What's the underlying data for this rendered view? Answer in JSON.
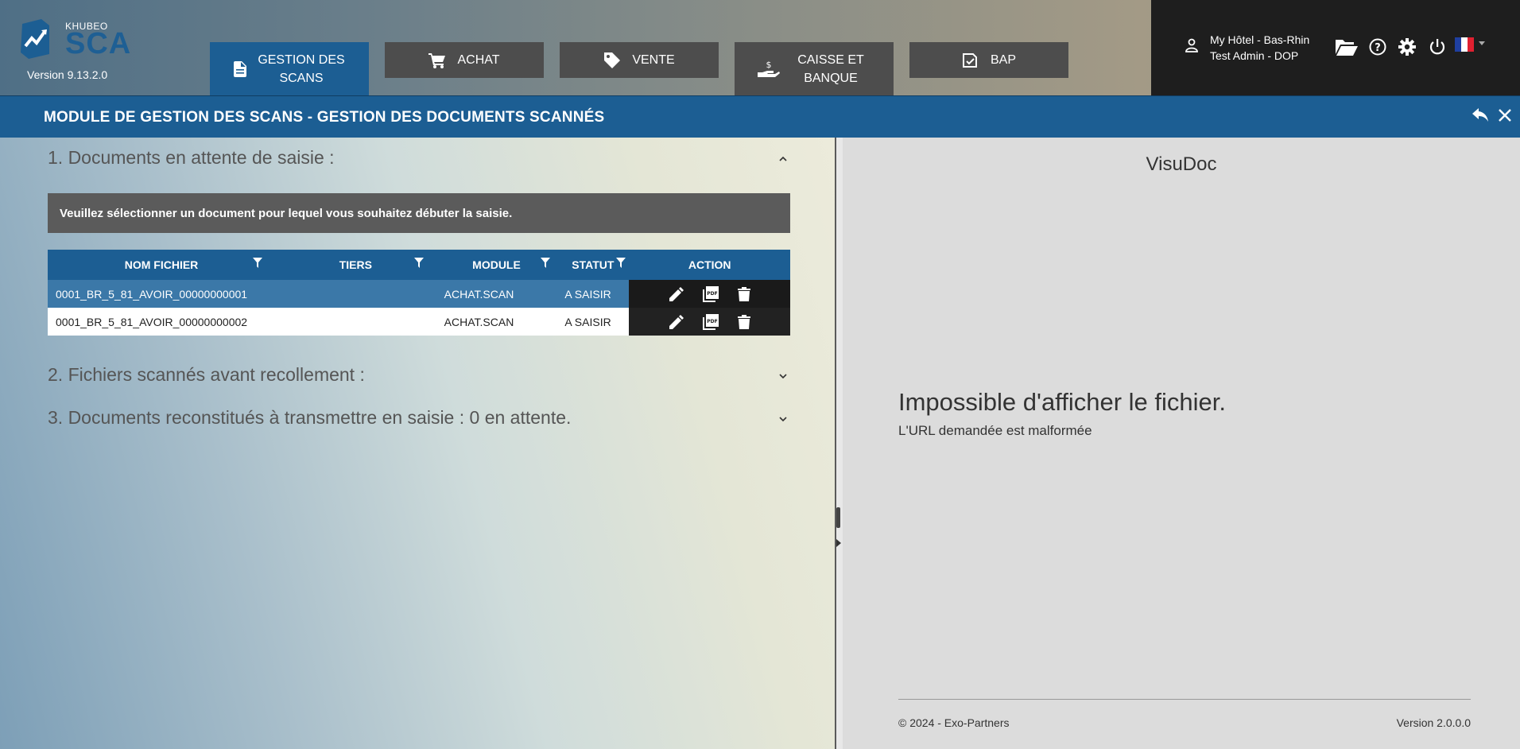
{
  "app": {
    "logo_brand": "KHUBEO",
    "logo_product": "SCA",
    "version": "Version 9.13.2.0"
  },
  "nav": {
    "items": [
      {
        "label": "GESTION DES SCANS",
        "icon": "document-icon",
        "active": true
      },
      {
        "label": "ACHAT",
        "icon": "cart-icon",
        "active": false
      },
      {
        "label": "VENTE",
        "icon": "tag-icon",
        "active": false
      },
      {
        "label": "CAISSE ET BANQUE",
        "icon": "hand-money-icon",
        "active": false
      },
      {
        "label": "BAP",
        "icon": "validate-doc-icon",
        "active": false
      }
    ]
  },
  "user": {
    "hotel": "My Hôtel - Bas-Rhin",
    "name": "Test Admin - DOP",
    "icons": [
      "user-icon",
      "folder-open-icon",
      "help-icon",
      "gear-icon",
      "power-icon",
      "flag-fr-icon"
    ]
  },
  "titlebar": {
    "title": "MODULE DE GESTION DES SCANS - GESTION DES DOCUMENTS SCANNÉS"
  },
  "sections": {
    "pending": {
      "title": "1. Documents en attente de saisie :",
      "expanded": true,
      "notice": "Veuillez sélectionner un document pour lequel vous souhaitez débuter la saisie.",
      "table": {
        "headers": [
          "NOM FICHIER",
          "TIERS",
          "MODULE",
          "STATUT",
          "ACTION"
        ],
        "rows": [
          {
            "nom": "0001_BR_5_81_AVOIR_00000000001",
            "tiers": "",
            "module": "ACHAT.SCAN",
            "statut": "A SAISIR",
            "selected": true
          },
          {
            "nom": "0001_BR_5_81_AVOIR_00000000002",
            "tiers": "",
            "module": "ACHAT.SCAN",
            "statut": "A SAISIR",
            "selected": false
          }
        ]
      }
    },
    "scanned": {
      "title": "2. Fichiers scannés avant recollement :",
      "expanded": false
    },
    "rebuilt": {
      "title": "3. Documents reconstitués à transmettre en saisie : 0 en attente.",
      "expanded": false
    }
  },
  "visudoc": {
    "title": "VisuDoc",
    "error_title": "Impossible d'afficher le fichier.",
    "error_message": "L'URL demandée est malformée",
    "footer_left": "© 2024 - Exo-Partners",
    "footer_right": "Version 2.0.0.0"
  },
  "colors": {
    "primary": "#1c5e93",
    "nav_inactive": "#4d4d4d",
    "selected_row": "#3b78a8",
    "dark_panel": "#1e1e1e"
  }
}
